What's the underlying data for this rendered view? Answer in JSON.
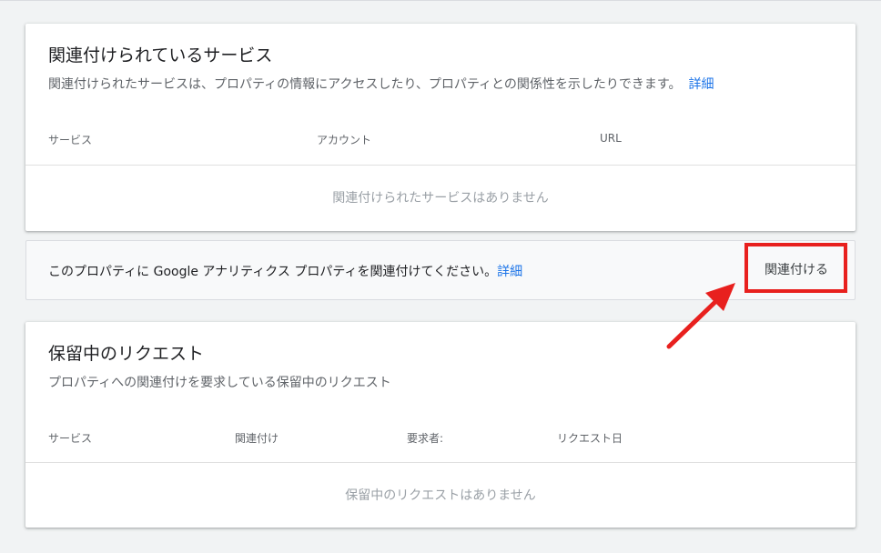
{
  "linked_services": {
    "title": "関連付けられているサービス",
    "subtitle": "関連付けられたサービスは、プロパティの情報にアクセスしたり、プロパティとの関係性を示したりできます。",
    "details_link": "詳細",
    "columns": [
      "サービス",
      "アカウント",
      "URL"
    ],
    "empty_message": "関連付けられたサービスはありません"
  },
  "banner": {
    "text": "このプロパティに Google アナリティクス プロパティを関連付けてください。",
    "details_link": "詳細",
    "link_button": "関連付ける"
  },
  "pending_requests": {
    "title": "保留中のリクエスト",
    "subtitle": "プロパティへの関連付けを要求している保留中のリクエスト",
    "columns": [
      "サービス",
      "関連付け",
      "要求者:",
      "リクエスト日"
    ],
    "empty_message": "保留中のリクエストはありません"
  },
  "colors": {
    "background": "#f1f3f4",
    "link": "#1a73e8",
    "highlight": "#e8201e"
  },
  "annotation": {
    "highlight": "red-box",
    "arrow": "red-arrow"
  }
}
